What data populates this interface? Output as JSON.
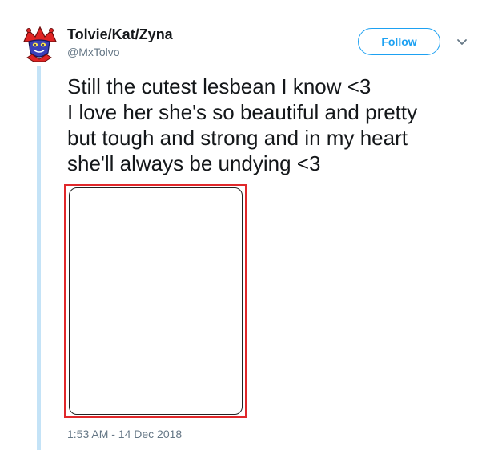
{
  "user": {
    "display_name": "Tolvie/Kat/Zyna",
    "handle": "@MxTolvo"
  },
  "follow_label": "Follow",
  "tweet": {
    "lines": [
      "Still the cutest lesbean I know <3",
      "I love her she's so beautiful and pretty",
      "but tough and strong and in my heart",
      "she'll always be undying <3"
    ],
    "timestamp": "1:53 AM - 14 Dec 2018"
  },
  "colors": {
    "accent": "#1da1f2",
    "thread_line": "#c4e3f7",
    "media_highlight": "#e0282b",
    "text_primary": "#14171a",
    "text_secondary": "#657786"
  },
  "icons": {
    "avatar": "jester-avatar",
    "menu": "chevron-down-icon"
  }
}
